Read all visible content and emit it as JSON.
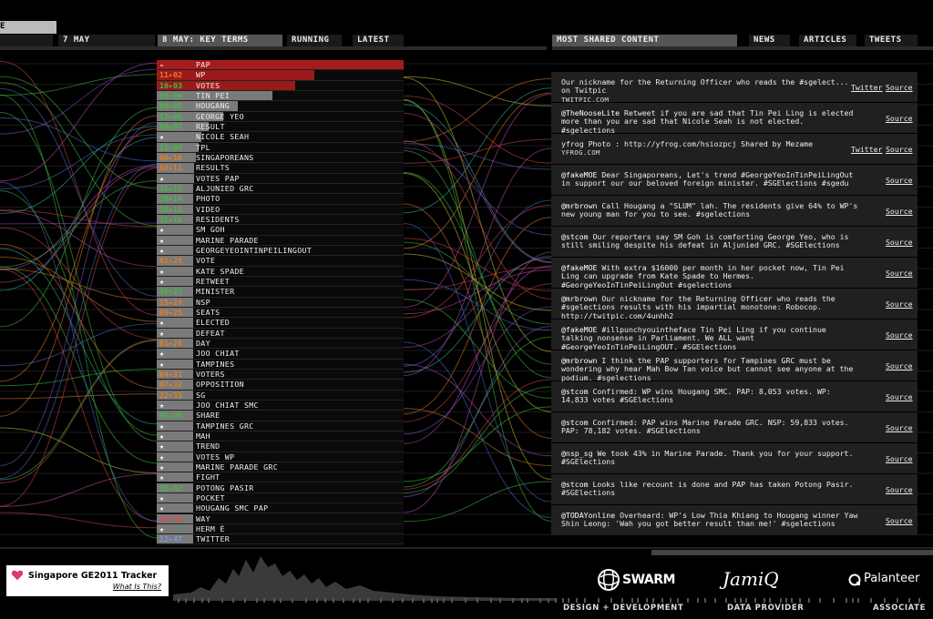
{
  "nav": {
    "left_tab_partial": "E",
    "date_tab": "7 MAY",
    "key_terms_tab": "8 MAY: KEY TERMS",
    "running_tab": "RUNNING",
    "latest_tab": "LATEST",
    "shared_tab": "MOST SHARED CONTENT",
    "news_tab": "NEWS",
    "articles_tab": "ARTICLES",
    "tweets_tab": "TWEETS"
  },
  "colors": {
    "red": "#c0392b",
    "orange": "#e67e22",
    "green": "#3fbf3f",
    "blue": "#4a6fcf",
    "gray": "#7a7a7a",
    "darkred": "#8b1515"
  },
  "terms": [
    {
      "rank": "-",
      "label": "PAP",
      "bar": 1.0,
      "color": "darkred"
    },
    {
      "rank": "11▸02",
      "label": "WP",
      "bar": 0.64,
      "color": "darkred"
    },
    {
      "rank": "10▸03",
      "label": "VOTES",
      "bar": 0.56,
      "color": "darkred"
    },
    {
      "rank": "03▸04",
      "label": "TIN PEI",
      "bar": 0.47,
      "color": "gray"
    },
    {
      "rank": "09▸05",
      "label": "HOUGANG",
      "bar": 0.33,
      "color": "gray"
    },
    {
      "rank": "13▸06",
      "label": "GEORGE YEO",
      "bar": 0.27,
      "color": "gray"
    },
    {
      "rank": "08▸07",
      "label": "RESULT",
      "bar": 0.21,
      "color": "gray"
    },
    {
      "rank": "★",
      "label": "NICOLE SEAH",
      "bar": 0.18,
      "color": "gray"
    },
    {
      "rank": "18▸09",
      "label": "TPL",
      "bar": 0.17,
      "color": "gray"
    },
    {
      "rank": "06▸10",
      "label": "SINGAPOREANS",
      "bar": 0.16,
      "color": "gray"
    },
    {
      "rank": "02▸11",
      "label": "RESULTS",
      "bar": 0.15,
      "color": "gray"
    },
    {
      "rank": "★",
      "label": "VOTES PAP",
      "bar": 0.15,
      "color": "gray"
    },
    {
      "rank": "35▸13",
      "label": "ALJUNIED GRC",
      "bar": 0.14,
      "color": "gray"
    },
    {
      "rank": "30▸14",
      "label": "PHOTO",
      "bar": 0.14,
      "color": "gray"
    },
    {
      "rank": "28▸15",
      "label": "VIDEO",
      "bar": 0.13,
      "color": "gray"
    },
    {
      "rank": "32▸16",
      "label": "RESIDENTS",
      "bar": 0.13,
      "color": "gray"
    },
    {
      "rank": "★",
      "label": "SM GOH",
      "bar": 0.13,
      "color": "gray"
    },
    {
      "rank": "★",
      "label": "MARINE PARADE",
      "bar": 0.13,
      "color": "gray"
    },
    {
      "rank": "★",
      "label": "GEORGEYEOINTINPEILINGOUT",
      "bar": 0.13,
      "color": "gray"
    },
    {
      "rank": "02▸20",
      "label": "VOTE",
      "bar": 0.13,
      "color": "gray"
    },
    {
      "rank": "★",
      "label": "KATE SPADE",
      "bar": 0.13,
      "color": "gray"
    },
    {
      "rank": "★",
      "label": "RETWEET",
      "bar": 0.13,
      "color": "gray"
    },
    {
      "rank": "40▸23",
      "label": "MINISTER",
      "bar": 0.13,
      "color": "gray"
    },
    {
      "rank": "15▸24",
      "label": "NSP",
      "bar": 0.12,
      "color": "gray"
    },
    {
      "rank": "09▸25",
      "label": "SEATS",
      "bar": 0.12,
      "color": "gray"
    },
    {
      "rank": "★",
      "label": "ELECTED",
      "bar": 0.12,
      "color": "gray"
    },
    {
      "rank": "★",
      "label": "DEFEAT",
      "bar": 0.12,
      "color": "gray"
    },
    {
      "rank": "01▸28",
      "label": "DAY",
      "bar": 0.12,
      "color": "gray"
    },
    {
      "rank": "★",
      "label": "JOO CHIAT",
      "bar": 0.12,
      "color": "gray"
    },
    {
      "rank": "★",
      "label": "TAMPINES",
      "bar": 0.12,
      "color": "gray"
    },
    {
      "rank": "04▸31",
      "label": "VOTERS",
      "bar": 0.11,
      "color": "gray"
    },
    {
      "rank": "07▸32",
      "label": "OPPOSITION",
      "bar": 0.11,
      "color": "gray"
    },
    {
      "rank": "22▸33",
      "label": "SG",
      "bar": 0.11,
      "color": "gray"
    },
    {
      "rank": "★",
      "label": "JOO CHIAT SMC",
      "bar": 0.11,
      "color": "gray"
    },
    {
      "rank": "01▸35",
      "label": "SHARE",
      "bar": 0.11,
      "color": "gray"
    },
    {
      "rank": "★",
      "label": "TAMPINES GRC",
      "bar": 0.1,
      "color": "gray"
    },
    {
      "rank": "★",
      "label": "MAH",
      "bar": 0.1,
      "color": "gray"
    },
    {
      "rank": "★",
      "label": "TREND",
      "bar": 0.1,
      "color": "gray"
    },
    {
      "rank": "★",
      "label": "VOTES WP",
      "bar": 0.1,
      "color": "gray"
    },
    {
      "rank": "★",
      "label": "MARINE PARADE GRC",
      "bar": 0.1,
      "color": "gray"
    },
    {
      "rank": "★",
      "label": "FIGHT",
      "bar": 0.1,
      "color": "gray"
    },
    {
      "rank": "33▸42",
      "label": "POTONG PASIR",
      "bar": 0.1,
      "color": "gray"
    },
    {
      "rank": "★",
      "label": "POCKET",
      "bar": 0.1,
      "color": "gray"
    },
    {
      "rank": "★",
      "label": "HOUGANG SMC PAP",
      "bar": 0.1,
      "color": "gray"
    },
    {
      "rank": "14▸45",
      "label": "WAY",
      "bar": 0.09,
      "color": "gray"
    },
    {
      "rank": "★",
      "label": "HERM È",
      "bar": 0.09,
      "color": "gray"
    },
    {
      "rank": "12▸47",
      "label": "TWITTER",
      "bar": 0.09,
      "color": "gray"
    }
  ],
  "rank_colors": {
    "11▸02": "orange",
    "10▸03": "green",
    "03▸04": "green",
    "09▸05": "green",
    "13▸06": "green",
    "08▸07": "green",
    "18▸09": "green",
    "06▸10": "orange",
    "02▸11": "orange",
    "35▸13": "green",
    "30▸14": "green",
    "28▸15": "green",
    "32▸16": "green",
    "02▸20": "orange",
    "40▸23": "green",
    "15▸24": "orange",
    "09▸25": "orange",
    "01▸28": "orange",
    "04▸31": "orange",
    "07▸32": "orange",
    "22▸33": "orange",
    "01▸35": "green",
    "33▸42": "green",
    "14▸45": "red",
    "12▸47": "blue"
  },
  "shared": [
    {
      "user": "",
      "text": "Our nickname for the Returning Officer who reads the #sgelect... on Twitpic",
      "domain": "TWITPIC.COM",
      "twitter": "Twitter",
      "source": "Source"
    },
    {
      "user": "@TheNooseLite",
      "text": " Retweet if you are sad that Tin Pei Ling is elected more than you are sad that Nicole Seah is not elected. #sgelections",
      "domain": "",
      "twitter": "",
      "source": "Source"
    },
    {
      "user": "",
      "text": "yfrog Photo : http://yfrog.com/hsiozpcj Shared by Mezame",
      "domain": "YFROG.COM",
      "twitter": "Twitter",
      "source": "Source"
    },
    {
      "user": "@fakeMOE",
      "text": " Dear Singaporeans, Let's trend #GeorgeYeoInTinPeiLingOut in support our our beloved foreign minister. #SGElections #sgedu",
      "domain": "",
      "twitter": "",
      "source": "Source"
    },
    {
      "user": "@mrbrown",
      "text": " Call Hougang a \"SLUM\" lah. The residents give 64% to WP's new young man for you to see. #sgelections",
      "domain": "",
      "twitter": "",
      "source": "Source"
    },
    {
      "user": "@stcom",
      "text": " Our reporters say SM Goh is comforting George Yeo, who is still smiling despite his defeat in Aljunied GRC. #SGElections",
      "domain": "",
      "twitter": "",
      "source": "Source"
    },
    {
      "user": "@fakeMOE",
      "text": " With extra $16000 per month in her pocket now, Tin Pei Ling can upgrade from Kate Spade to Hermes. #GeorgeYeoInTinPeiLingOut #sgelections",
      "domain": "",
      "twitter": "",
      "source": "Source"
    },
    {
      "user": "@mrbrown",
      "text": " Our nickname for the Returning Officer who reads the #sgelections results with his impartial monotone: Robocop. http://twitpic.com/4unhh2",
      "domain": "",
      "twitter": "",
      "source": "Source"
    },
    {
      "user": "@fakeMOE",
      "text": " #illpunchyouintheface Tin Pei Ling if you continue talking nonsense in Parliament. We ALL want #GeorgeYeoInTinPeiLingOUT. #SGElections",
      "domain": "",
      "twitter": "",
      "source": "Source"
    },
    {
      "user": "@mrbrown",
      "text": " I think the PAP supporters for Tampines GRC must be wondering why hear Mah Bow Tan voice but cannot see anyone at the podium. #sgelections",
      "domain": "",
      "twitter": "",
      "source": "Source"
    },
    {
      "user": "@stcom",
      "text": " Confirmed: WP wins Hougang SMC. PAP: 8,053 votes. WP: 14,833 votes #SGElections",
      "domain": "",
      "twitter": "",
      "source": "Source"
    },
    {
      "user": "@stcom",
      "text": " Confirmed: PAP wins Marine Parade GRC. NSP: 59,833 votes. PAP: 78,182 votes. #SGElections",
      "domain": "",
      "twitter": "",
      "source": "Source"
    },
    {
      "user": "@nsp_sg",
      "text": " We took 43% in Marine Parade. Thank you for your support. #SGElections",
      "domain": "",
      "twitter": "",
      "source": "Source"
    },
    {
      "user": "@stcom",
      "text": " Looks like recount is done and PAP has taken Potong Pasir. #SGElections",
      "domain": "",
      "twitter": "",
      "source": "Source"
    },
    {
      "user": "@TODAYonline",
      "text": " Overheard: WP's Low Thia Khiang to Hougang winner Yaw Shin Leong: 'Wah you got better result than me!' #sgelections",
      "domain": "",
      "twitter": "",
      "source": "Source"
    }
  ],
  "footer": {
    "tracker_title": "Singapore GE2011 Tracker",
    "what_link": "What Is This?",
    "swarm_logo": "SWARM",
    "jamiq_logo": "JamiQ",
    "palanteer_logo": "Palanteer",
    "design_caption": "DESIGN + DEVELOPMENT",
    "data_caption": "DATA PROVIDER",
    "associate_caption": "ASSOCIATE"
  },
  "icons": [
    "heart-icon",
    "swarm-globe-icon",
    "palanteer-mark-icon",
    "star-icon"
  ]
}
